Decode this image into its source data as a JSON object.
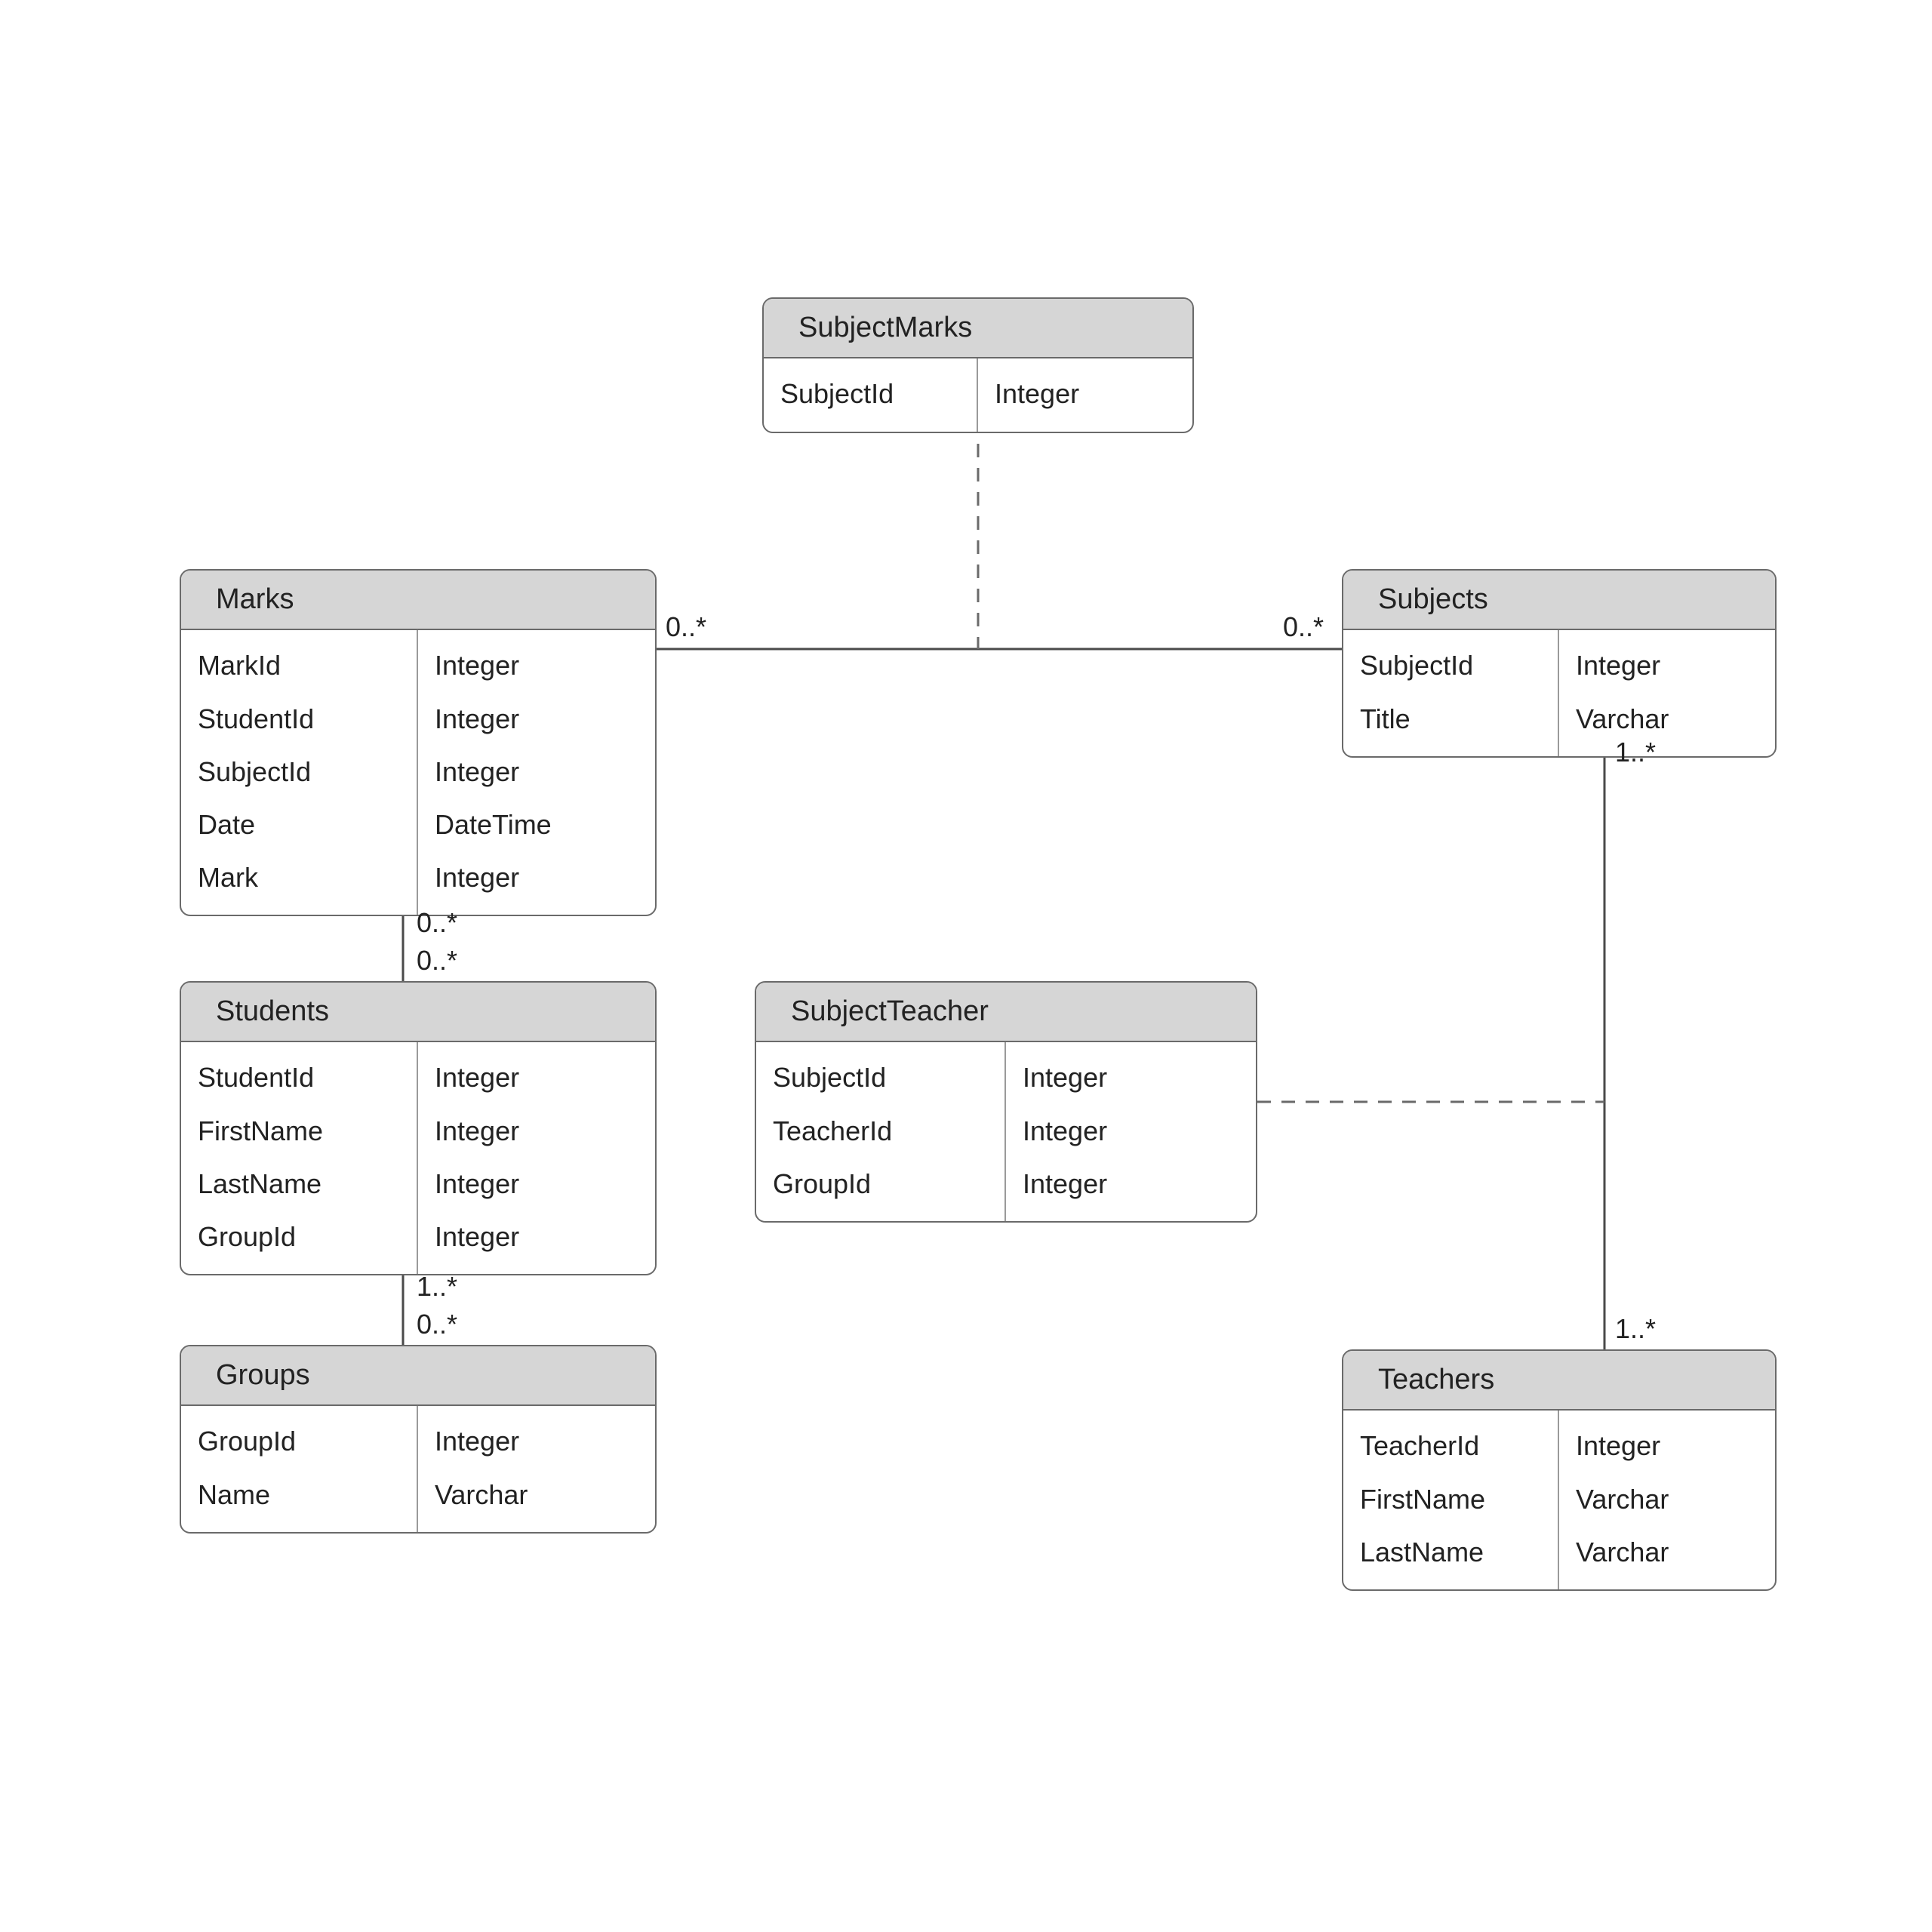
{
  "entities": {
    "subjectMarks": {
      "title": "SubjectMarks",
      "rows": [
        {
          "name": "SubjectId",
          "type": "Integer"
        }
      ]
    },
    "marks": {
      "title": "Marks",
      "rows": [
        {
          "name": "MarkId",
          "type": "Integer"
        },
        {
          "name": "StudentId",
          "type": "Integer"
        },
        {
          "name": "SubjectId",
          "type": "Integer"
        },
        {
          "name": "Date",
          "type": "DateTime"
        },
        {
          "name": "Mark",
          "type": "Integer"
        }
      ]
    },
    "subjects": {
      "title": "Subjects",
      "rows": [
        {
          "name": "SubjectId",
          "type": "Integer"
        },
        {
          "name": "Title",
          "type": "Varchar"
        }
      ]
    },
    "students": {
      "title": "Students",
      "rows": [
        {
          "name": "StudentId",
          "type": "Integer"
        },
        {
          "name": "FirstName",
          "type": "Integer"
        },
        {
          "name": "LastName",
          "type": "Integer"
        },
        {
          "name": "GroupId",
          "type": "Integer"
        }
      ]
    },
    "subjectTeacher": {
      "title": "SubjectTeacher",
      "rows": [
        {
          "name": "SubjectId",
          "type": "Integer"
        },
        {
          "name": "TeacherId",
          "type": "Integer"
        },
        {
          "name": "GroupId",
          "type": "Integer"
        }
      ]
    },
    "groups": {
      "title": "Groups",
      "rows": [
        {
          "name": "GroupId",
          "type": "Integer"
        },
        {
          "name": "Name",
          "type": "Varchar"
        }
      ]
    },
    "teachers": {
      "title": "Teachers",
      "rows": [
        {
          "name": "TeacherId",
          "type": "Integer"
        },
        {
          "name": "FirstName",
          "type": "Varchar"
        },
        {
          "name": "LastName",
          "type": "Varchar"
        }
      ]
    }
  },
  "multiplicities": {
    "marks_right": "0..*",
    "subjects_left": "0..*",
    "marks_bottom": "0..*",
    "students_top": "0..*",
    "students_bottom": "1..*",
    "groups_top": "0..*",
    "subjects_bottom": "1..*",
    "teachers_top": "1..*"
  }
}
